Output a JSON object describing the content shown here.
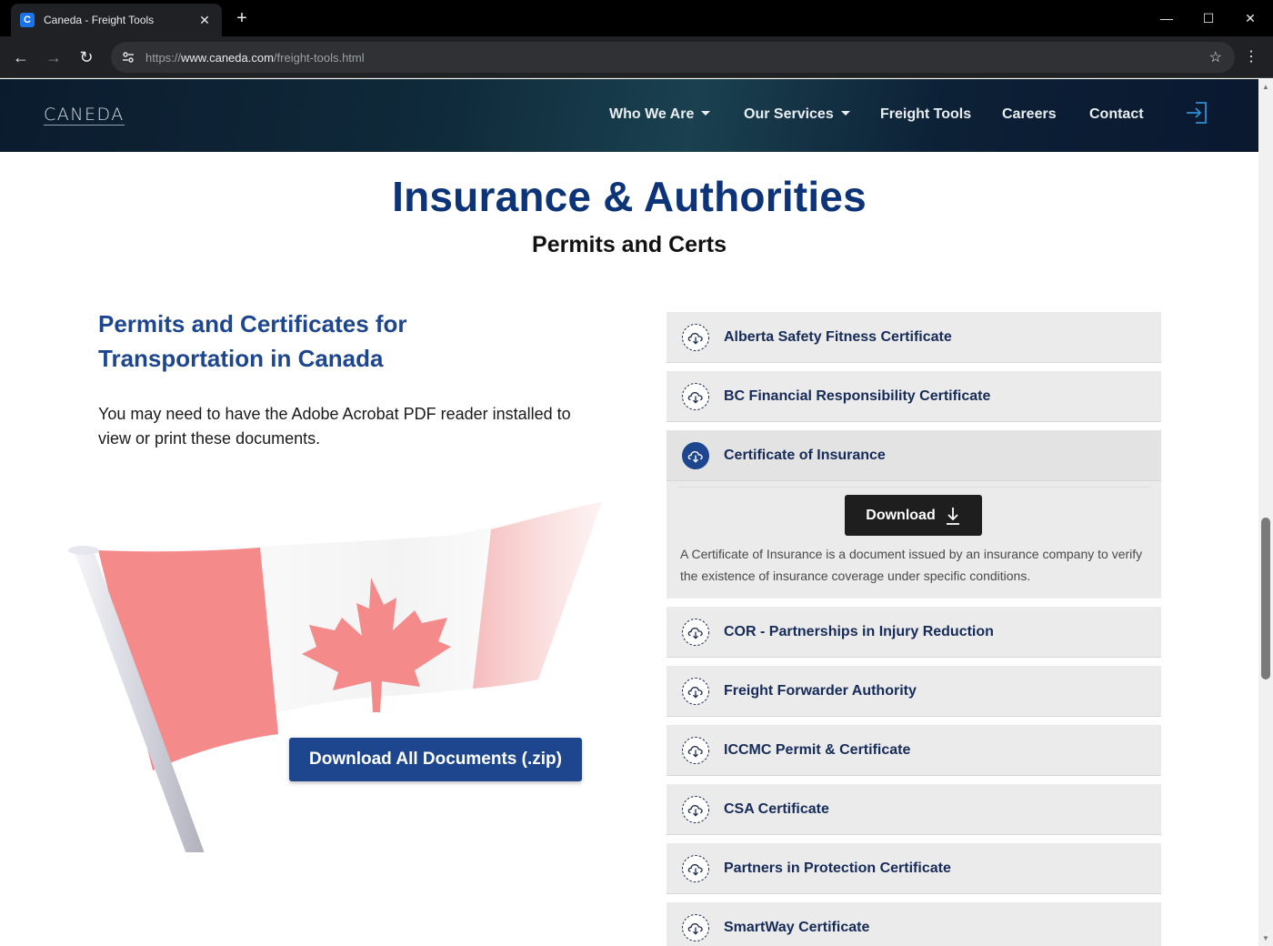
{
  "browser": {
    "tab_title": "Caneda - Freight Tools",
    "tab_favicon_letter": "C",
    "url_scheme": "https://",
    "url_host": "www.caneda.com",
    "url_path": "/freight-tools.html"
  },
  "header": {
    "logo": "CANEDA",
    "nav": [
      {
        "label": "Who We Are",
        "dropdown": true
      },
      {
        "label": "Our Services",
        "dropdown": true
      },
      {
        "label": "Freight Tools",
        "dropdown": false
      },
      {
        "label": "Careers",
        "dropdown": false
      },
      {
        "label": "Contact",
        "dropdown": false
      }
    ]
  },
  "page": {
    "title": "Insurance & Authorities",
    "subtitle": "Permits and Certs",
    "left_title": "Permits and Certificates for Transportation in Canada",
    "left_text": "You may need to have the Adobe Acrobat PDF reader installed to view or print these documents.",
    "zip_button": "Download All Documents (.zip)"
  },
  "accordion": {
    "items": [
      {
        "label": "Alberta Safety Fitness Certificate",
        "open": false
      },
      {
        "label": "BC Financial Responsibility Certificate",
        "open": false
      },
      {
        "label": "Certificate of Insurance",
        "open": true
      },
      {
        "label": "COR - Partnerships in Injury Reduction",
        "open": false
      },
      {
        "label": "Freight Forwarder Authority",
        "open": false
      },
      {
        "label": "ICCMC Permit & Certificate",
        "open": false
      },
      {
        "label": "CSA Certificate",
        "open": false
      },
      {
        "label": "Partners in Protection Certificate",
        "open": false
      },
      {
        "label": "SmartWay Certificate",
        "open": false
      }
    ],
    "open_panel": {
      "download_label": "Download",
      "description": "A Certificate of Insurance is a document issued by an insurance company to verify the existence of insurance coverage under specific conditions."
    }
  },
  "colors": {
    "brand_blue": "#1d468f",
    "title_blue": "#0d3478",
    "item_text": "#162b58",
    "flag_red": "#f48a8a"
  },
  "icons": {
    "accordion_item": "cloud-download-icon",
    "login": "login-icon",
    "download": "download-arrow-icon"
  }
}
